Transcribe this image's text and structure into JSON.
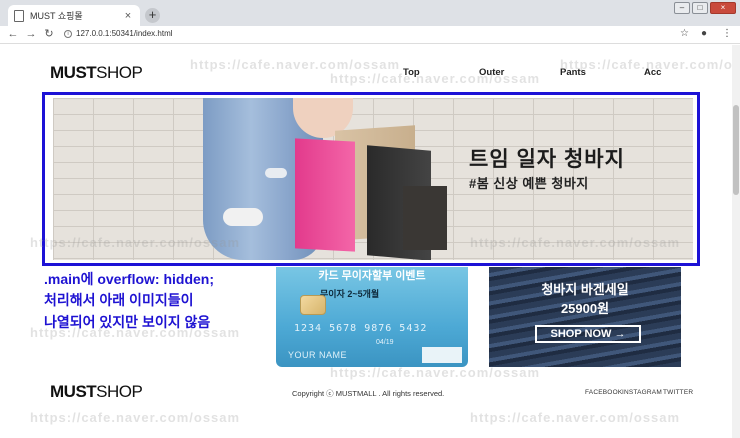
{
  "browser": {
    "tab_title": "MUST 쇼핑몰",
    "tab_close": "×",
    "new_tab": "+",
    "url": "127.0.0.1:50341/index.html",
    "back": "←",
    "forward": "→",
    "reload": "↻",
    "star": "☆",
    "account": "●",
    "menu": "⋮",
    "info": "i",
    "win_min": "–",
    "win_max": "□",
    "win_close": "×"
  },
  "header": {
    "logo_bold": "MUST",
    "logo_light": "SHOP",
    "nav": [
      "Top",
      "Outer",
      "Pants",
      "Acc"
    ]
  },
  "hero": {
    "title": "트임 일자 청바지",
    "subtitle": "#봄 신상 예쁜 청바지"
  },
  "annotation": {
    "lines": [
      ".main에 overflow: hidden;",
      "처리해서 아래 이미지들이",
      "나열되어 있지만 보이지 않음"
    ]
  },
  "promo_card": {
    "title": "카드 무이자할부 이벤트",
    "subtitle": "무이자 2~5개월",
    "card_number": "1234  5678  9876  5432",
    "card_sub": "04/19",
    "card_name": "YOUR NAME"
  },
  "sale_card": {
    "title": "청바지 바겐세일",
    "price": "25900원",
    "button": "SHOP NOW →"
  },
  "footer": {
    "logo_bold": "MUST",
    "logo_light": "SHOP",
    "copyright": "Copyright ⓒ MUSTMALL . All rights reserved.",
    "sns": [
      "FACEBOOK",
      "INSTAGRAM",
      "TWITTER"
    ]
  },
  "watermark": "https://cafe.naver.com/ossam",
  "colors": {
    "annotation_blue": "#1e12d2",
    "frame_blue": "#1d12d6"
  }
}
